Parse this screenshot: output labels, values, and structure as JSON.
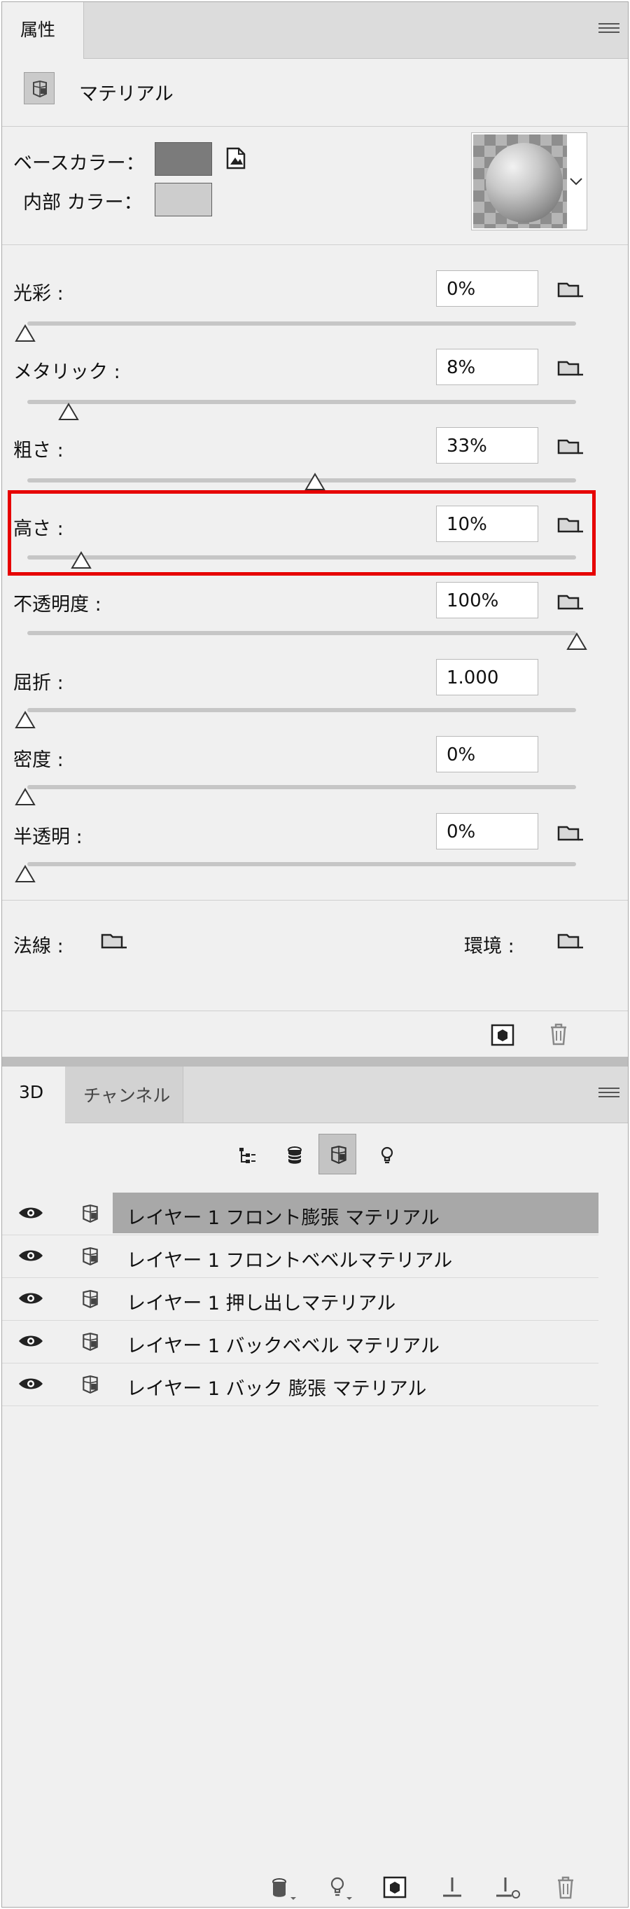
{
  "properties_panel": {
    "tab_label": "属性",
    "header": {
      "title": "マテリアル",
      "icon": "material-icon"
    },
    "base_color": {
      "label": "ベースカラー：",
      "swatch_color": "#7b7b7b",
      "texture_icon": "edit-texture-icon"
    },
    "interior_color": {
      "label": "内部 カラー：",
      "swatch_color": "#cdcdcd"
    },
    "material_picker": {
      "icon": "chevron-down-icon"
    },
    "sliders": [
      {
        "label": "光彩 :",
        "value": "0%",
        "level": 0
      },
      {
        "label": "メタリック :",
        "value": "8%",
        "level": 0.08
      },
      {
        "label": "粗さ :",
        "value": "33%",
        "level": 0.33
      },
      {
        "label": "高さ :",
        "value": "10%",
        "level": 0.1
      },
      {
        "label": "不透明度 :",
        "value": "100%",
        "level": 1.0
      },
      {
        "label": "屈折 :",
        "value": "1.000",
        "level": 0
      },
      {
        "label": "密度 :",
        "value": "0%",
        "level": 0
      },
      {
        "label": "半透明 :",
        "value": "0%",
        "level": 0
      }
    ],
    "normal": {
      "label": "法線 :"
    },
    "environment": {
      "label": "環境 :"
    },
    "highlight_color": "#e60000"
  },
  "panel_3d": {
    "tabs": [
      {
        "label": "3D"
      },
      {
        "label": "チャンネル"
      }
    ],
    "filters": [
      "scene-filter-icon",
      "mesh-filter-icon",
      "material-filter-icon",
      "light-filter-icon"
    ],
    "items": [
      {
        "label": "レイヤー 1 フロント膨張 マテリアル",
        "selected": true
      },
      {
        "label": "レイヤー 1 フロントベベルマテリアル",
        "selected": false
      },
      {
        "label": "レイヤー 1 押し出しマテリアル",
        "selected": false
      },
      {
        "label": "レイヤー 1 バックベベル マテリアル",
        "selected": false
      },
      {
        "label": "レイヤー 1 バック 膨張 マテリアル",
        "selected": false
      }
    ]
  }
}
